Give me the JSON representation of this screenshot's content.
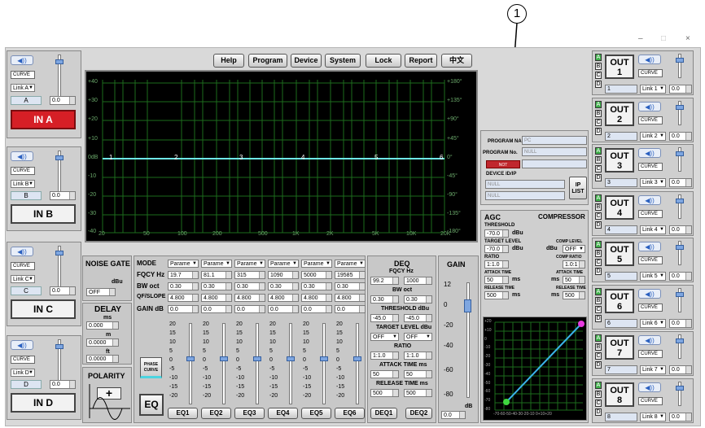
{
  "window": {
    "min": "–",
    "max": "□",
    "close": "×"
  },
  "callout": {
    "number": "1"
  },
  "toolbar": {
    "help": "Help",
    "program": "Program",
    "device": "Device",
    "system": "System",
    "lock": "Lock",
    "report": "Report",
    "lang": "中文"
  },
  "graph": {
    "left_ticks": [
      "+40",
      "+30",
      "+20",
      "+10",
      "0dB",
      "-10",
      "-20",
      "-30",
      "-40"
    ],
    "right_ticks": [
      "+180°",
      "+135°",
      "+90°",
      "+45°",
      "0°",
      "-45°",
      "-90°",
      "-135°",
      "-180°"
    ],
    "freq_ticks": [
      "20",
      "50",
      "100",
      "200",
      "500",
      "1K",
      "2K",
      "5K",
      "10K",
      "20K"
    ],
    "points": [
      "1",
      "2",
      "3",
      "4",
      "5",
      "6"
    ]
  },
  "inputs": [
    {
      "link": "Link A",
      "name": "A",
      "gain": "0.0",
      "button": "IN A",
      "active": true
    },
    {
      "link": "Link B",
      "name": "B",
      "gain": "0.0",
      "button": "IN B",
      "active": false
    },
    {
      "link": "Link C",
      "name": "C",
      "gain": "0.0",
      "button": "IN C",
      "active": false
    },
    {
      "link": "Link D",
      "name": "D",
      "gain": "0.0",
      "button": "IN D",
      "active": false
    }
  ],
  "curve_label": "CURVE",
  "speaker_icon": "◀))",
  "noise_gate": {
    "title": "NOISE GATE",
    "unit": "dBu",
    "value": "OFF"
  },
  "delay": {
    "title": "DELAY",
    "ms_label": "ms",
    "ms": "0.000",
    "m_label": "m",
    "m": "0.0000",
    "ft_label": "ft",
    "ft": "0.0000"
  },
  "polarity": {
    "title": "POLARITY",
    "plus": "+"
  },
  "eq": {
    "mode_label": "MODE",
    "fqcy_label": "FQCY Hz",
    "bw_label": "BW oct",
    "slope_label": "QF/SLOPE",
    "gain_label": "GAIN dB",
    "phase_curve": "PHASE CURVE",
    "eq_button": "EQ",
    "bands": [
      {
        "mode": "Parame",
        "fqcy": "19.7",
        "bw": "0.30",
        "slope": "4.800",
        "gain": "0.0",
        "btn": "EQ1"
      },
      {
        "mode": "Parame",
        "fqcy": "81.1",
        "bw": "0.30",
        "slope": "4.800",
        "gain": "0.0",
        "btn": "EQ2"
      },
      {
        "mode": "Parame",
        "fqcy": "315",
        "bw": "0.30",
        "slope": "4.800",
        "gain": "0.0",
        "btn": "EQ3"
      },
      {
        "mode": "Parame",
        "fqcy": "1090",
        "bw": "0.30",
        "slope": "4.800",
        "gain": "0.0",
        "btn": "EQ4"
      },
      {
        "mode": "Parame",
        "fqcy": "5000",
        "bw": "0.30",
        "slope": "4.800",
        "gain": "0.0",
        "btn": "EQ5"
      },
      {
        "mode": "Parame",
        "fqcy": "19585",
        "bw": "0.30",
        "slope": "4.800",
        "gain": "0.0",
        "btn": "EQ6"
      }
    ],
    "scale": [
      "20",
      "15",
      "10",
      "5",
      "0",
      "-5",
      "-10",
      "-15",
      "-20"
    ]
  },
  "deq": {
    "title": "DEQ",
    "fqcy_label": "FQCY Hz",
    "fqcy": [
      "99.2",
      "1000"
    ],
    "bw_label": "BW oct",
    "bw": [
      "0.30",
      "0.30"
    ],
    "threshold_label": "THRESHOLD dBu",
    "threshold": [
      "-45.0",
      "-45.0"
    ],
    "target_label": "TARGET LEVEL dBu",
    "target": [
      "OFF",
      "OFF"
    ],
    "ratio_label": "RATIO",
    "ratio": [
      "1:1.0",
      "1:1.0"
    ],
    "attack_label": "ATTACK TIME ms",
    "attack": [
      "50",
      "50"
    ],
    "release_label": "RELEASE TIME ms",
    "release": [
      "500",
      "500"
    ],
    "btn1": "DEQ1",
    "btn2": "DEQ2"
  },
  "gain": {
    "title": "GAIN",
    "scale": [
      "12",
      "0",
      "-20",
      "-40",
      "-60",
      "-80"
    ],
    "unit": "dB",
    "value": "0.0"
  },
  "program": {
    "name_label": "PROGRAM NAME",
    "name": "PC",
    "no_label": "PROGRAM No.",
    "no": "NULL",
    "status": "NOT CONNECTED",
    "device_label": "DEVICE ID/IP",
    "device1": "NULL",
    "device2": "NULL",
    "ip_list": "IP LIST"
  },
  "agc": {
    "agc_title": "AGC",
    "comp_title": "COMPRESSOR",
    "threshold_label": "THRESHOLD",
    "threshold": "-70.0",
    "dbu": "dBu",
    "target_label": "TARGET LEVEL",
    "target": "-70.0",
    "comp_level_label": "COMP LEVEL",
    "comp_level": "OFF",
    "ratio_label": "RATIO",
    "ratio": "1:1.0",
    "comp_ratio_label": "COMP RATIO",
    "comp_ratio": "1.0:1",
    "attack_label": "ATTACK TIME",
    "attack": "50",
    "comp_attack_label": "ATTACK TIME",
    "comp_attack": "50",
    "ms": "ms",
    "release_label": "RELEASE TIME",
    "release": "500",
    "comp_release_label": "RELEASE TIME",
    "comp_release": "500",
    "graph_y": [
      "+20",
      "+10",
      "0",
      "-10",
      "-20",
      "-30",
      "-40",
      "-50",
      "-60",
      "-70",
      "-80"
    ],
    "graph_x": "-70-60-50-40-30-20-10 0+10+20"
  },
  "outputs": [
    {
      "num": "1",
      "name": "1",
      "link": "Link 1",
      "gain": "0.0"
    },
    {
      "num": "2",
      "name": "2",
      "link": "Link 2",
      "gain": "0.0"
    },
    {
      "num": "3",
      "name": "3",
      "link": "Link 3",
      "gain": "0.0"
    },
    {
      "num": "4",
      "name": "4",
      "link": "Link 4",
      "gain": "0.0"
    },
    {
      "num": "5",
      "name": "5",
      "link": "Link 5",
      "gain": "0.0"
    },
    {
      "num": "6",
      "name": "6",
      "link": "Link 6",
      "gain": "0.0"
    },
    {
      "num": "7",
      "name": "7",
      "link": "Link 7",
      "gain": "0.0"
    },
    {
      "num": "8",
      "name": "8",
      "link": "Link 8",
      "gain": "0.0"
    }
  ],
  "out_label": "OUT",
  "abcd": [
    "A",
    "B",
    "C",
    "D"
  ]
}
